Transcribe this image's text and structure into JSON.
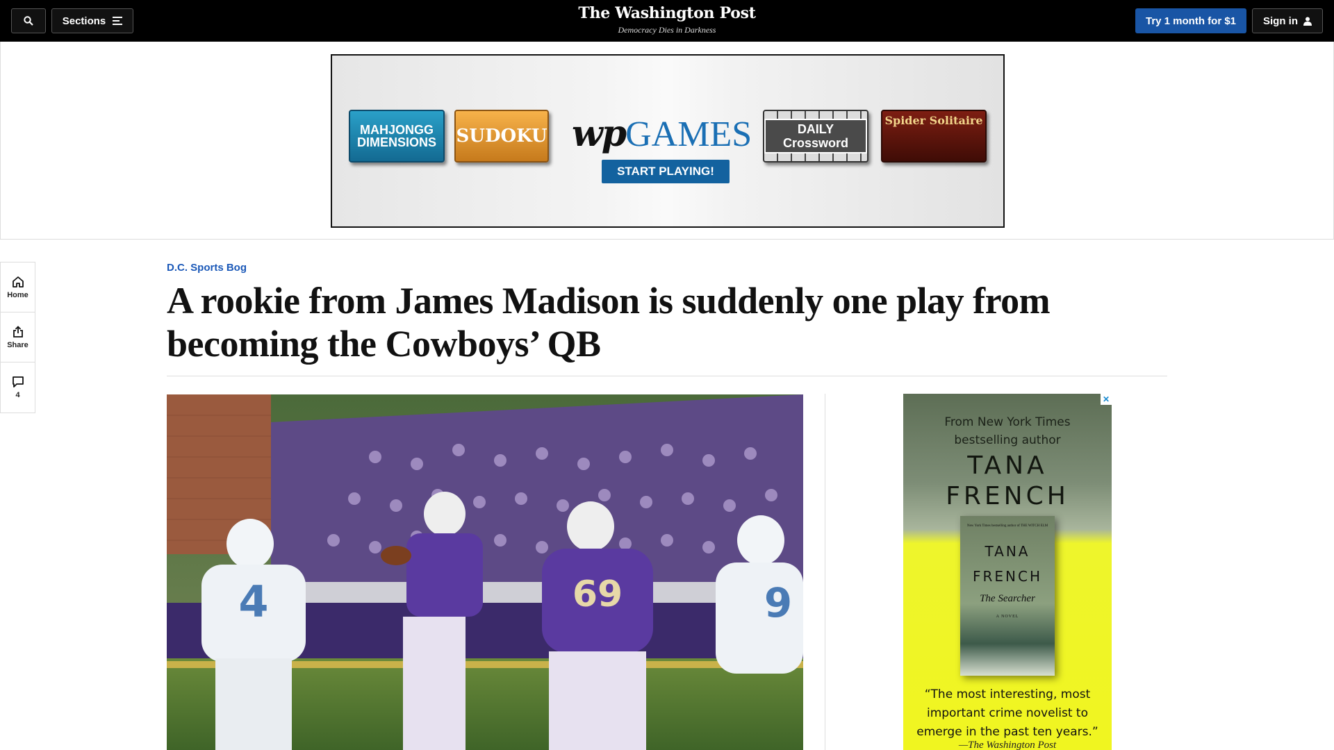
{
  "topbar": {
    "sections_label": "Sections",
    "logo": "The Washington Post",
    "tagline": "Democracy Dies in Darkness",
    "try_label": "Try 1 month for $1",
    "signin_label": "Sign in"
  },
  "banner_ad": {
    "tiles": [
      "MAHJONGG DIMENSIONS",
      "SUDOKU",
      "DAILY Crossword",
      "Spider Solitaire"
    ],
    "logo_wp": "wp",
    "logo_games": "GAMES",
    "cta": "START PLAYING!"
  },
  "rail": {
    "home_label": "Home",
    "share_label": "Share",
    "comment_count": "4"
  },
  "article": {
    "kicker": "D.C. Sports Bog",
    "headline": "A rookie from James Madison is suddenly one play from becoming the Cowboys’ QB"
  },
  "side_ad": {
    "from_line1": "From New York Times",
    "from_line2": "bestselling author",
    "author_line1": "TANA",
    "author_line2": "FRENCH",
    "book_top": "New York Times bestselling author of THE WITCH ELM",
    "book_author1": "TANA",
    "book_author2": "FRENCH",
    "book_title": "The Searcher",
    "book_type": "A NOVEL",
    "quote": "“The most interesting, most important crime novelist to emerge in the past ten years.”",
    "attribution": "—The Washington Post"
  },
  "colors": {
    "topbar_bg": "#000000",
    "accent_blue": "#1955a5",
    "kicker_blue": "#1a58b8"
  }
}
